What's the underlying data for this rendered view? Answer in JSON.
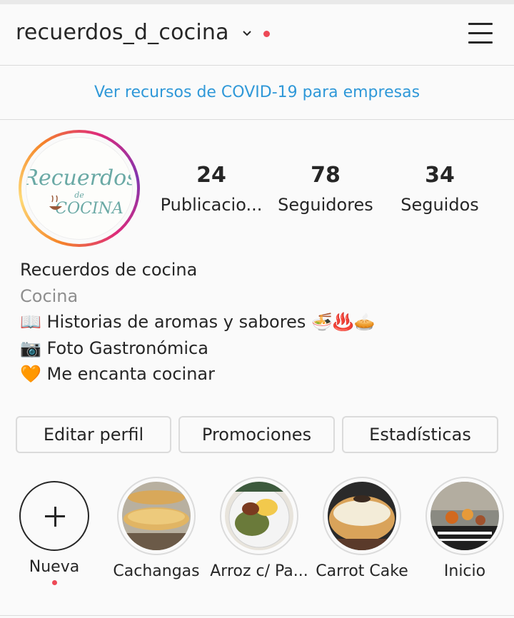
{
  "header": {
    "username": "recuerdos_d_cocina"
  },
  "banner": {
    "covid_link": "Ver recursos de COVID-19 para empresas"
  },
  "profile": {
    "avatar_text_1": "Recuerdos",
    "avatar_text_2": "de",
    "avatar_text_3": "COCINA",
    "stats": [
      {
        "value": "24",
        "label": "Publicacio..."
      },
      {
        "value": "78",
        "label": "Seguidores"
      },
      {
        "value": "34",
        "label": "Seguidos"
      }
    ],
    "name": "Recuerdos de cocina",
    "category": "Cocina",
    "bio_lines": [
      "📖 Historias de aromas y sabores 🍜♨️🥧",
      "📷 Foto Gastronómica",
      "🧡 Me encanta cocinar"
    ]
  },
  "actions": {
    "edit": "Editar perfil",
    "promotions": "Promociones",
    "stats": "Estadísticas"
  },
  "highlights": [
    {
      "label": "Nueva"
    },
    {
      "label": "Cachangas"
    },
    {
      "label": "Arroz c/ Pa..."
    },
    {
      "label": "Carrot Cake"
    },
    {
      "label": "Inicio"
    }
  ],
  "colors": {
    "link": "#2f98d8",
    "notification": "#ed4956",
    "border": "#dbdbdb"
  }
}
